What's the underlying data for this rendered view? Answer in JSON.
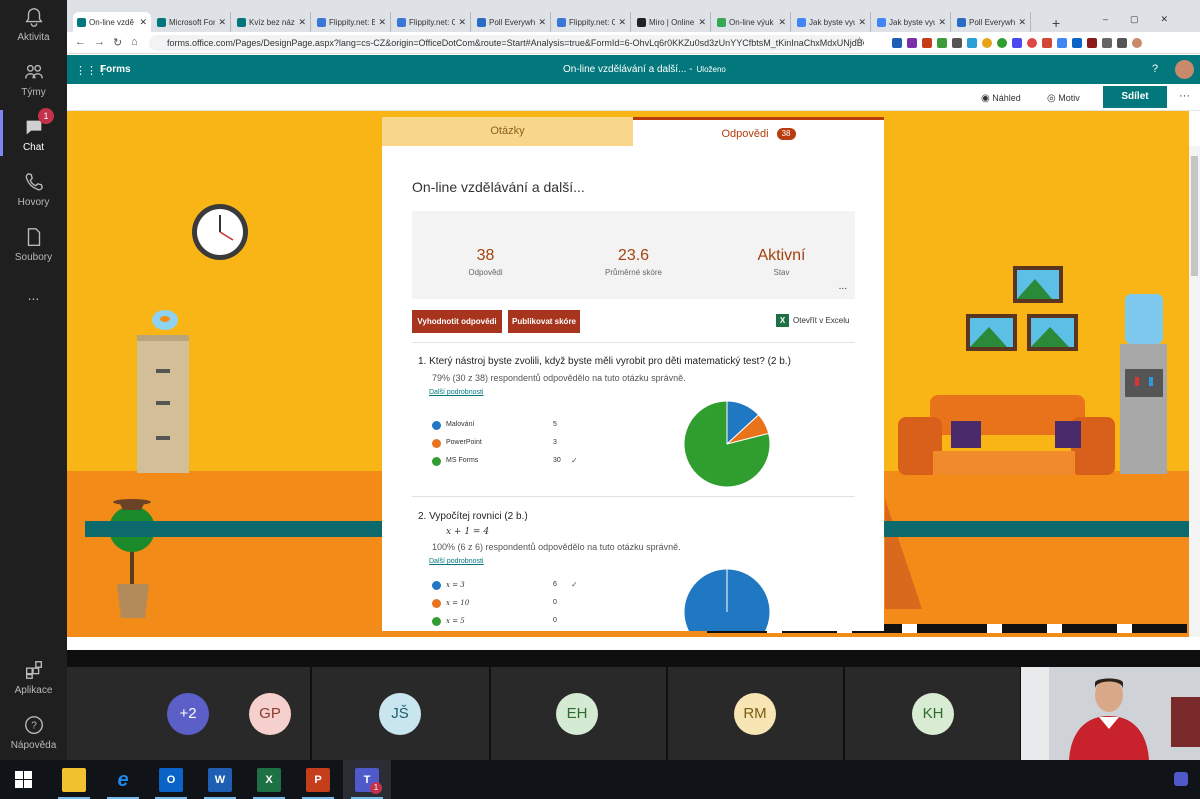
{
  "teams_rail": {
    "items": [
      {
        "label": "Aktivita"
      },
      {
        "label": "Týmy"
      },
      {
        "label": "Chat",
        "badge": "1"
      },
      {
        "label": "Hovory"
      },
      {
        "label": "Soubory"
      }
    ],
    "more": "...",
    "bottom": [
      {
        "label": "Aplikace"
      },
      {
        "label": "Nápověda"
      }
    ]
  },
  "browser": {
    "tabs": [
      {
        "title": "On-line vzdě",
        "color": "#03787c"
      },
      {
        "title": "Microsoft For",
        "color": "#03787c"
      },
      {
        "title": "Kvíz bez názv",
        "color": "#03787c"
      },
      {
        "title": "Flippity.net: E",
        "color": "#3a78d8"
      },
      {
        "title": "Flippity.net: C",
        "color": "#3a78d8"
      },
      {
        "title": "Poll Everywhe",
        "color": "#2a6bc4"
      },
      {
        "title": "Flippity.net: C",
        "color": "#3a78d8"
      },
      {
        "title": "Miro | Online",
        "color": "#222222"
      },
      {
        "title": "On-line výuk",
        "color": "#34a853"
      },
      {
        "title": "Jak byste vyu",
        "color": "#4285f4"
      },
      {
        "title": "Jak byste vyu",
        "color": "#4285f4"
      },
      {
        "title": "Poll Everywhe",
        "color": "#2a6bc4"
      }
    ],
    "new_tab": "+",
    "url": "forms.office.com/Pages/DesignPage.aspx?lang=cs-CZ&origin=OfficeDotCom&route=Start#Analysis=true&FormId=6-OhvLq6r0KKZu0sd3zUnYYCfbtsM_tKinInaChxMdxUNjdBQ1BMNFF..."
  },
  "forms": {
    "app_name": "Forms",
    "doc_title": "On-line vzdělávání a další... -",
    "saved": "Uloženo",
    "help": "?",
    "commands": {
      "preview": "Náhled",
      "theme": "Motiv",
      "share": "Sdílet",
      "more": "···"
    },
    "tabs": {
      "questions": "Otázky",
      "responses": "Odpovědi",
      "responses_count": "38"
    },
    "title": "On-line vzdělávání a další...",
    "stats": [
      {
        "value": "38",
        "label": "Odpovědi"
      },
      {
        "value": "23.6",
        "label": "Průměrné skóre"
      },
      {
        "value": "Aktivní",
        "label": "Stav"
      }
    ],
    "stats_more": "...",
    "buttons": {
      "review": "Vyhodnotit odpovědi",
      "publish": "Publikovat skóre",
      "excel": "Otevřít v Excelu"
    },
    "questions": [
      {
        "title": "1.  Který nástroj byste zvolili, když byste měli vyrobit pro děti matematický test? (2 b.)",
        "summary": "79% (30 z 38) respondentů odpovědělo na tuto otázku správně.",
        "details_link": "Další podrobnosti",
        "options": [
          {
            "label": "Malování",
            "count": 5,
            "color": "#1f78c1",
            "correct": false
          },
          {
            "label": "PowerPoint",
            "count": 3,
            "color": "#e8731a",
            "correct": false
          },
          {
            "label": "MS Forms",
            "count": 30,
            "color": "#2f9e2f",
            "correct": true
          }
        ]
      },
      {
        "title": "2.  Vypočítej rovnici (2 b.)",
        "equation": "x + 1 = 4",
        "summary": "100% (6 z 6) respondentů odpovědělo na tuto otázku správně.",
        "details_link": "Další podrobnosti",
        "options": [
          {
            "label": "x = 3",
            "count": 6,
            "color": "#1f78c1",
            "correct": true
          },
          {
            "label": "x = 10",
            "count": 0,
            "color": "#e8731a",
            "correct": false
          },
          {
            "label": "x = 5",
            "count": 0,
            "color": "#2f9e2f",
            "correct": false
          }
        ]
      }
    ],
    "check_mark": "✓"
  },
  "meeting": {
    "participants": [
      {
        "initials": "+2",
        "bg": "#5b5fc7",
        "fg": "#ffffff"
      },
      {
        "initials": "GP",
        "bg": "#f6d0cc",
        "fg": "#8b3a30"
      },
      {
        "initials": "JŠ",
        "bg": "#c9e6ef",
        "fg": "#1f5d73"
      },
      {
        "initials": "EH",
        "bg": "#d4ead2",
        "fg": "#2f6b2f"
      },
      {
        "initials": "RM",
        "bg": "#f7e6b4",
        "fg": "#7a5c10"
      },
      {
        "initials": "KH",
        "bg": "#d8ecd4",
        "fg": "#2f6b2f"
      }
    ]
  },
  "taskbar": {
    "apps": [
      {
        "name": "file-explorer",
        "glyph": "",
        "color": "#f2c130"
      },
      {
        "name": "internet-explorer",
        "glyph": "e",
        "color": "#1e88e5"
      },
      {
        "name": "outlook",
        "glyph": "O",
        "color": "#0a64c8"
      },
      {
        "name": "word",
        "glyph": "W",
        "color": "#1e5fb3"
      },
      {
        "name": "excel",
        "glyph": "X",
        "color": "#1e7145"
      },
      {
        "name": "powerpoint",
        "glyph": "P",
        "color": "#c43e1c"
      },
      {
        "name": "teams",
        "glyph": "T",
        "color": "#5059c9",
        "badge": "1"
      }
    ]
  },
  "colors": {
    "teal": "#03787c",
    "rust": "#a7341c",
    "scene_wall": "#f9b515",
    "scene_floor": "#f28b18"
  }
}
